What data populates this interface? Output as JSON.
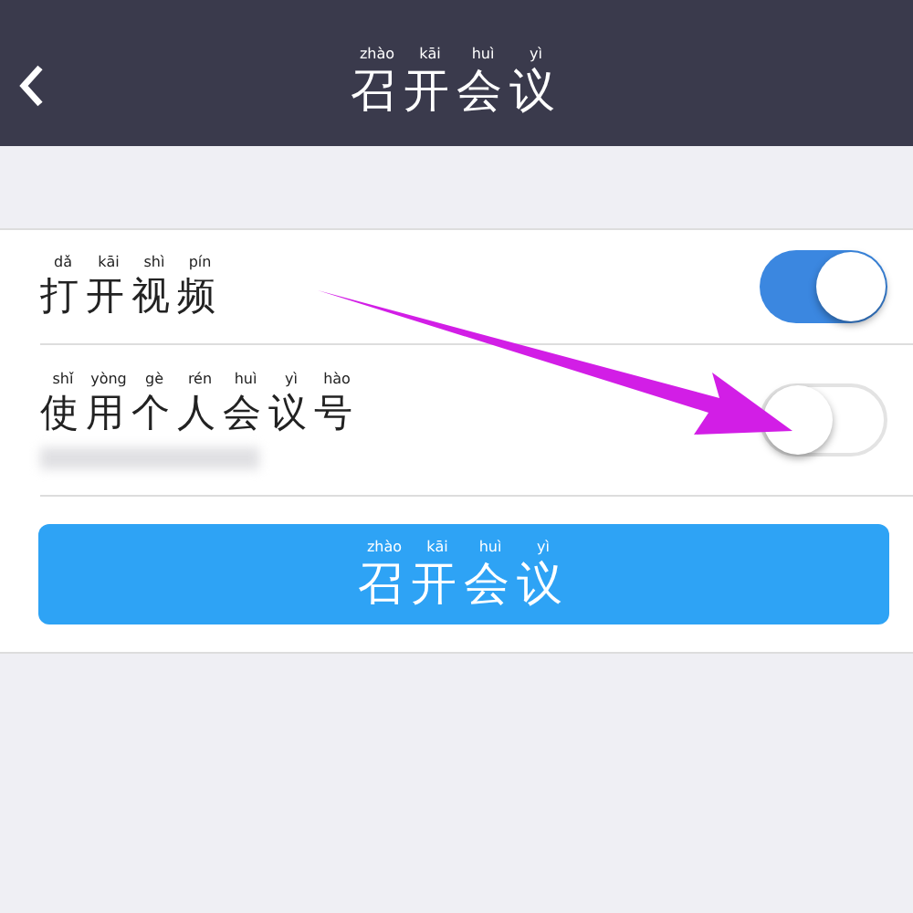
{
  "header": {
    "title": {
      "text": "召开会议",
      "pinyin": [
        "zhào",
        "kāi",
        "huì",
        "yì"
      ]
    }
  },
  "settings": [
    {
      "label": {
        "text": "打开视频",
        "pinyin": [
          "dǎ",
          "kāi",
          "shì",
          "pín"
        ]
      },
      "on": true,
      "blurred_note": false
    },
    {
      "label": {
        "text": "使用个人会议号",
        "pinyin": [
          "shǐ",
          "yòng",
          "gè",
          "rén",
          "huì",
          "yì",
          "hào"
        ]
      },
      "on": false,
      "blurred_note": true
    }
  ],
  "start_button": {
    "text": "召开会议",
    "pinyin": [
      "zhào",
      "kāi",
      "huì",
      "yì"
    ]
  }
}
